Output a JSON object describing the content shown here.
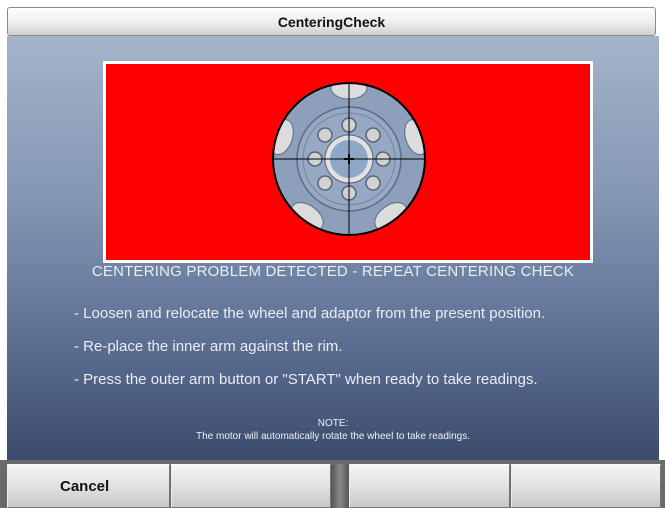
{
  "window": {
    "title": "CenteringCheck"
  },
  "message": {
    "heading": "CENTERING PROBLEM DETECTED - REPEAT CENTERING CHECK",
    "steps": [
      "- Loosen and relocate the wheel and adaptor from the present position.",
      "- Re-place the inner arm against the rim.",
      "- Press the outer arm button or \"START\" when ready to take readings."
    ],
    "note_title": "NOTE:",
    "note_text": "The motor will automatically rotate the wheel to take readings."
  },
  "softkeys": [
    {
      "label": "Cancel"
    },
    {
      "label": ""
    },
    {
      "label": ""
    },
    {
      "label": ""
    }
  ],
  "image": {
    "icon": "wheel-crosshair-icon",
    "background_color": "#ff0000"
  },
  "colors": {
    "panel_top": "#a3b4ca",
    "panel_bottom": "#3b4b6c",
    "text": "#e9edf4"
  }
}
